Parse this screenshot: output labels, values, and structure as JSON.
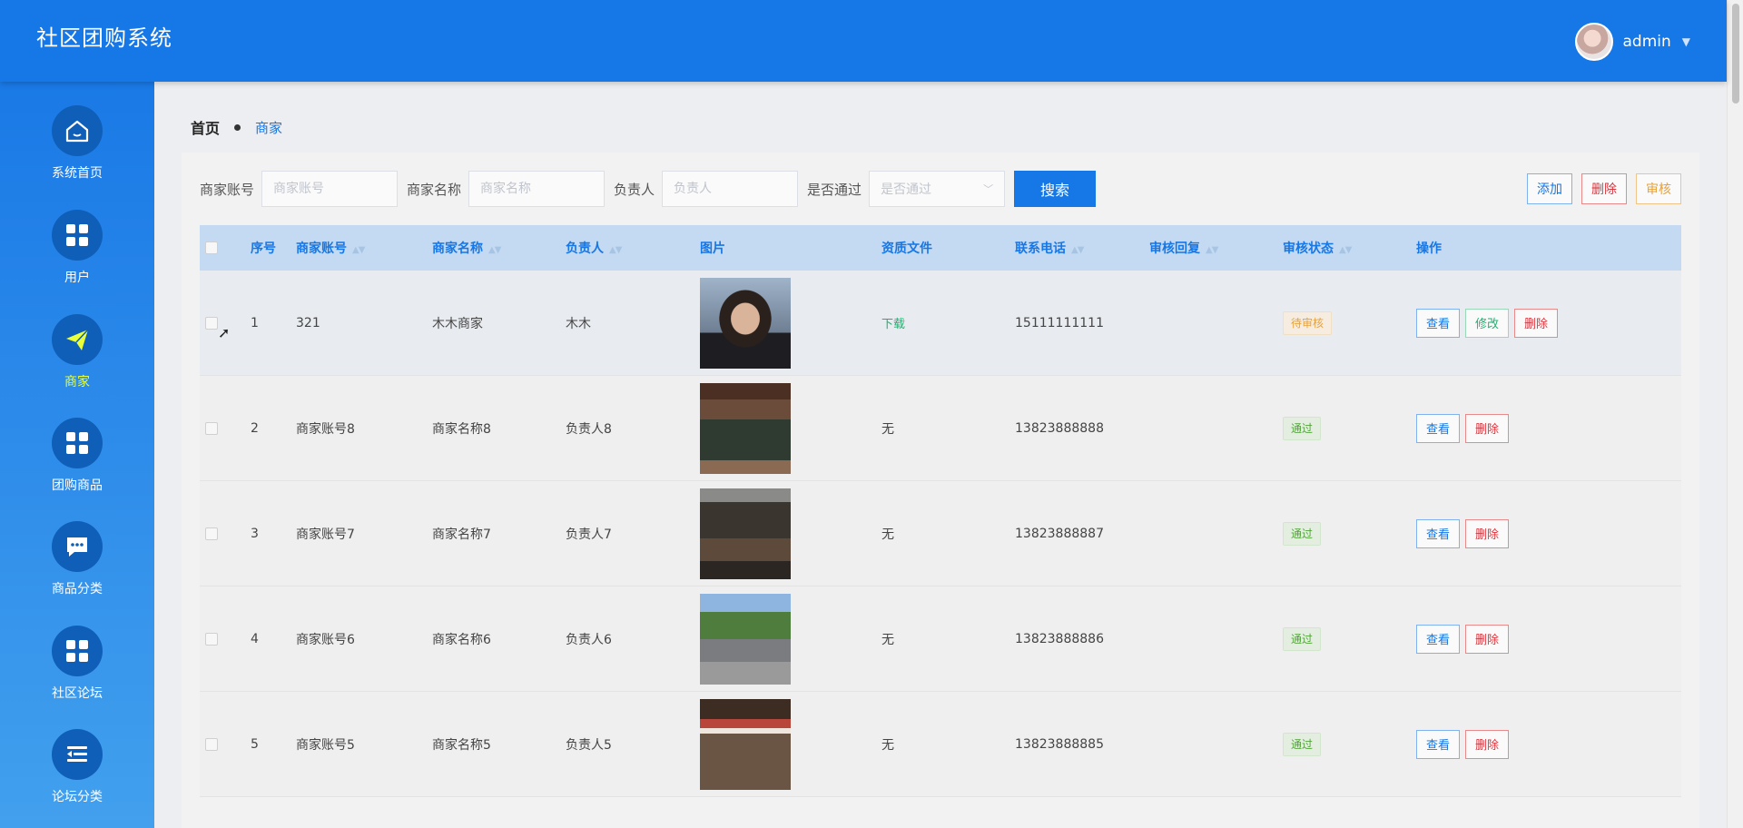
{
  "header": {
    "title": "社区团购系统",
    "user": "admin"
  },
  "sidebar": {
    "items": [
      {
        "label": "系统首页",
        "icon": "home-icon"
      },
      {
        "label": "用户",
        "icon": "grid-icon"
      },
      {
        "label": "商家",
        "icon": "paper-plane-icon",
        "active": true
      },
      {
        "label": "团购商品",
        "icon": "grid-icon"
      },
      {
        "label": "商品分类",
        "icon": "chat-icon"
      },
      {
        "label": "社区论坛",
        "icon": "grid-icon"
      },
      {
        "label": "论坛分类",
        "icon": "list-icon"
      }
    ]
  },
  "breadcrumb": {
    "home": "首页",
    "current": "商家"
  },
  "search": {
    "account_label": "商家账号",
    "account_placeholder": "商家账号",
    "name_label": "商家名称",
    "name_placeholder": "商家名称",
    "person_label": "负责人",
    "person_placeholder": "负责人",
    "pass_label": "是否通过",
    "pass_placeholder": "是否通过",
    "button": "搜索"
  },
  "actions": {
    "add": "添加",
    "delete": "删除",
    "review": "审核"
  },
  "table": {
    "headers": {
      "index": "序号",
      "account": "商家账号",
      "name": "商家名称",
      "person": "负责人",
      "image": "图片",
      "doc": "资质文件",
      "phone": "联系电话",
      "reply": "审核回复",
      "status": "审核状态",
      "ops": "操作"
    },
    "rows": [
      {
        "index": "1",
        "account": "321",
        "name": "木木商家",
        "person": "木木",
        "doc": "下载",
        "phone": "15111111111",
        "reply": "",
        "status": "待审核",
        "view": "查看",
        "edit": "修改",
        "delete": "删除"
      },
      {
        "index": "2",
        "account": "商家账号8",
        "name": "商家名称8",
        "person": "负责人8",
        "doc": "无",
        "phone": "13823888888",
        "reply": "",
        "status": "通过",
        "view": "查看",
        "delete": "删除"
      },
      {
        "index": "3",
        "account": "商家账号7",
        "name": "商家名称7",
        "person": "负责人7",
        "doc": "无",
        "phone": "13823888887",
        "reply": "",
        "status": "通过",
        "view": "查看",
        "delete": "删除"
      },
      {
        "index": "4",
        "account": "商家账号6",
        "name": "商家名称6",
        "person": "负责人6",
        "doc": "无",
        "phone": "13823888886",
        "reply": "",
        "status": "通过",
        "view": "查看",
        "delete": "删除"
      },
      {
        "index": "5",
        "account": "商家账号5",
        "name": "商家名称5",
        "person": "负责人5",
        "doc": "无",
        "phone": "13823888885",
        "reply": "",
        "status": "通过",
        "view": "查看",
        "delete": "删除"
      }
    ]
  },
  "colors": {
    "primary": "#1677e6",
    "active_nav": "#e8ff3a",
    "success": "#20b070",
    "danger": "#d9363e",
    "warning": "#e6a23c"
  }
}
